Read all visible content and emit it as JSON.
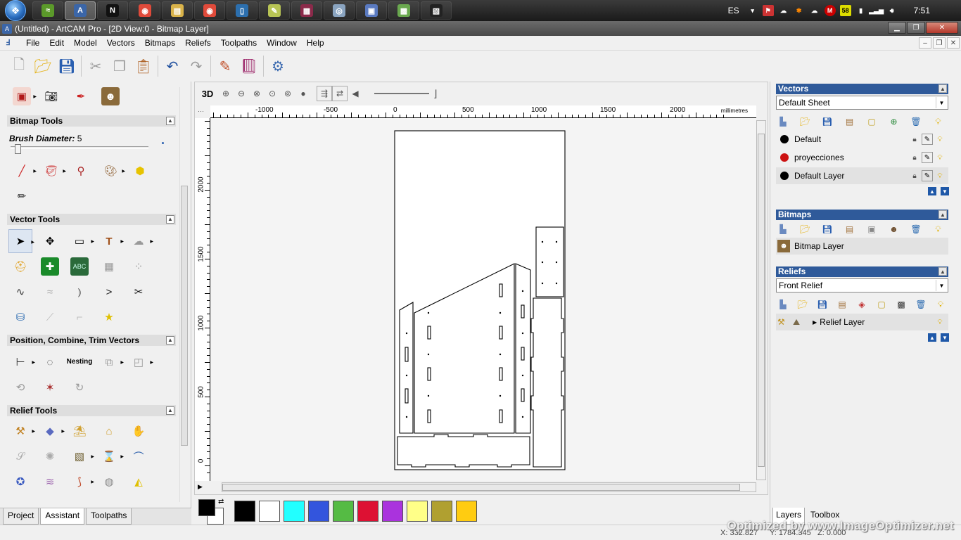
{
  "taskbar": {
    "apps": [
      {
        "name": "nvidia",
        "color": "#5b9a2a",
        "glyph": "≈",
        "active": false
      },
      {
        "name": "artcam",
        "color": "#3b66a8",
        "glyph": "A",
        "active": true
      },
      {
        "name": "notefx",
        "color": "#111111",
        "glyph": "N",
        "active": false
      },
      {
        "name": "chrome-1",
        "color": "#e04a3a",
        "glyph": "◉",
        "active": false
      },
      {
        "name": "explorer",
        "color": "#d9b34a",
        "glyph": "▤",
        "active": false
      },
      {
        "name": "chrome-2",
        "color": "#e04a3a",
        "glyph": "◉",
        "active": false
      },
      {
        "name": "app-blue",
        "color": "#2c6fae",
        "glyph": "▯",
        "active": false
      },
      {
        "name": "notepad",
        "color": "#b8c455",
        "glyph": "✎",
        "active": false
      },
      {
        "name": "winrar",
        "color": "#8b2a4a",
        "glyph": "▦",
        "active": false
      },
      {
        "name": "app-grey",
        "color": "#8aa4c0",
        "glyph": "◎",
        "active": false
      },
      {
        "name": "app-net",
        "color": "#5a7ac0",
        "glyph": "▣",
        "active": false
      },
      {
        "name": "app-green",
        "color": "#6aa84f",
        "glyph": "▩",
        "active": false
      },
      {
        "name": "app-film",
        "color": "#222222",
        "glyph": "▧",
        "active": false
      }
    ],
    "language": "ES",
    "tray_badge": "58",
    "clock": "7:51"
  },
  "titlebar": {
    "title": "(Untitled) - ArtCAM Pro - [2D View:0 - Bitmap Layer]"
  },
  "menu": [
    "File",
    "Edit",
    "Model",
    "Vectors",
    "Bitmaps",
    "Reliefs",
    "Toolpaths",
    "Window",
    "Help"
  ],
  "left_panel": {
    "bitmap_tools_title": "Bitmap Tools",
    "brush_label": "Brush Diameter:",
    "brush_value": "5",
    "vector_tools_title": "Vector Tools",
    "position_title": "Position, Combine, Trim Vectors",
    "relief_tools_title": "Relief Tools",
    "nesting_label": "Nesting"
  },
  "left_tabs": [
    "Project",
    "Assistant",
    "Toolpaths"
  ],
  "view": {
    "mode_3d": "3D",
    "hruler_labels": [
      "-1000",
      "-500",
      "0",
      "500",
      "1000",
      "1500",
      "2000"
    ],
    "ruler_unit": "millimetres",
    "vruler_labels": [
      "2000",
      "1500",
      "1000",
      "500",
      "0"
    ]
  },
  "palette": [
    "#000000",
    "#ffffff",
    "#22ffff",
    "#3355dd",
    "#55bb44",
    "#dd1133",
    "#aa33dd",
    "#ffff88",
    "#b0a030",
    "#ffcc11"
  ],
  "right_panel": {
    "vectors": {
      "title": "Vectors",
      "sheet": "Default Sheet",
      "layers": [
        {
          "name": "Default",
          "color": "#000000",
          "selected": false
        },
        {
          "name": "proyecciones",
          "color": "#cc1111",
          "selected": false
        },
        {
          "name": "Default Layer",
          "color": "#000000",
          "selected": true
        }
      ]
    },
    "bitmaps": {
      "title": "Bitmaps",
      "layer": "Bitmap Layer"
    },
    "reliefs": {
      "title": "Reliefs",
      "relief": "Front Relief",
      "layer": "Relief Layer"
    }
  },
  "right_tabs": [
    "Layers",
    "Toolbox"
  ],
  "status": {
    "x": "X: 332.827",
    "y": "Y: 1784.345",
    "z": "Z: 0.000"
  },
  "watermark": "Optimized by www.ImageOptimizer.net"
}
